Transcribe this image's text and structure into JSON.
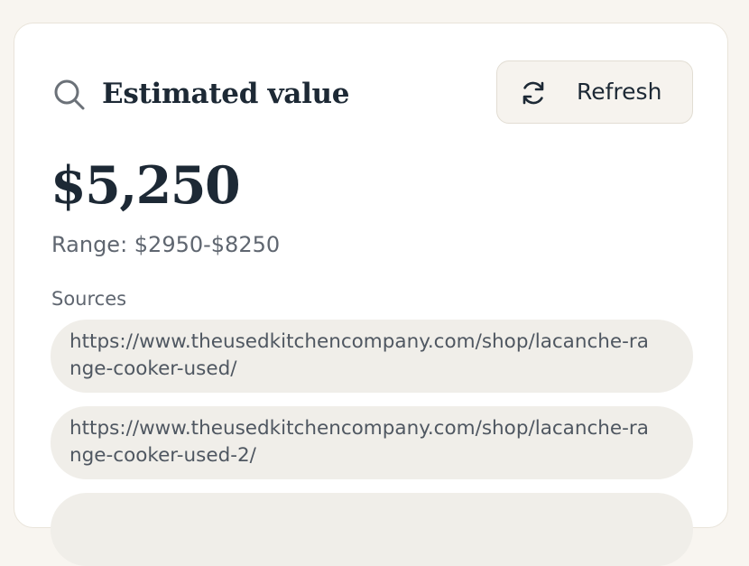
{
  "header": {
    "title": "Estimated value",
    "icon": "search-icon",
    "refresh_label": "Refresh",
    "refresh_icon": "refresh-icon"
  },
  "estimate": {
    "value": "$5,250",
    "range": "Range: $2950-$8250"
  },
  "sources": {
    "label": "Sources",
    "items": [
      "https://www.theusedkitchencompany.com/shop/lacanche-range-cooker-used/",
      "https://www.theusedkitchencompany.com/shop/lacanche-range-cooker-used-2/",
      ""
    ]
  },
  "colors": {
    "page_background": "#f8f5f0",
    "card_background": "#ffffff",
    "title_text": "#1d2935",
    "muted_text": "#5f6670",
    "pill_background": "#f0eee9",
    "button_background": "#f6f3ee"
  }
}
